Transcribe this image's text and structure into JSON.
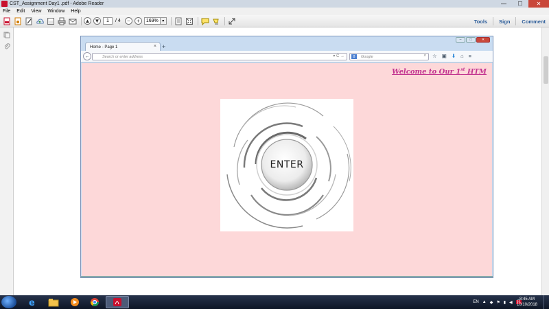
{
  "app": {
    "title": "CST_Assignment Day1 .pdf - Adobe Reader",
    "window_controls": {
      "minimize": "—",
      "maximize": "☐",
      "close": "✕"
    }
  },
  "menu": [
    "File",
    "Edit",
    "View",
    "Window",
    "Help"
  ],
  "toolbar": {
    "page_current": "1",
    "page_total": "/ 4",
    "zoom": "169%",
    "zoom_dropdown": "▾",
    "right_tools": [
      "Tools",
      "Sign",
      "Comment"
    ]
  },
  "document": {
    "browser": {
      "tab_title": "Home - Page 1",
      "tab_close": "×",
      "new_tab": "+",
      "back": "←",
      "url_placeholder": "Search or enter address",
      "url_icons": "▾ C →",
      "search_engine_badge": "8",
      "search_placeholder": "Google",
      "search_icon": "⌕",
      "toolbar_icons": [
        "☆",
        "▣",
        "⬇",
        "⌂",
        "≡"
      ]
    },
    "page": {
      "welcome_prefix": "Welcome to Our 1",
      "welcome_sup": "st",
      "welcome_suffix": " HTM",
      "enter_label": "ENTER",
      "background_color": "#fdd8d9",
      "accent_color": "#c2338f"
    }
  },
  "taskbar": {
    "language": "EN",
    "time": "8:45 AM",
    "date": "10/10/2018",
    "apps": [
      "ie-icon",
      "explorer-icon",
      "media-player-icon",
      "chrome-icon",
      "adobe-reader-icon"
    ]
  }
}
